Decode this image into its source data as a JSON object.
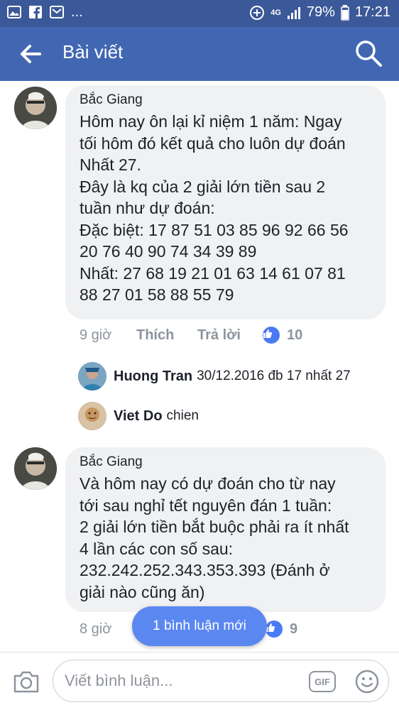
{
  "status_bar": {
    "network": "4G",
    "battery": "79%",
    "time": "17:21",
    "more": "..."
  },
  "header": {
    "title": "Bài viết",
    "back_icon": "arrow-left-icon",
    "search_icon": "search-icon"
  },
  "comments": [
    {
      "author": "Bắc Giang",
      "text": "Hôm nay ôn lại kỉ niệm 1 năm: Ngay\ntối hôm đó kết quả cho luôn dự đoán\nNhất 27.\nĐây là kq của 2 giải lớn tiền sau 2\ntuần như dự đoán:\nĐặc biệt: 17 87 51 03 85 96 92 66 56\n20  76 40 90 74 34 39 89\nNhất: 27 68 19 21 01 63 14 61 07 81\n88 27 01 58 88 55 79",
      "time": "9 giờ",
      "like_label": "Thích",
      "reply_label": "Trả lời",
      "likes": "10",
      "replies": [
        {
          "author": "Huong Tran",
          "text": "30/12.2016 đb 17 nhất  27"
        },
        {
          "author": "Viet Do",
          "text": "chien"
        }
      ]
    },
    {
      "author": "Bắc Giang",
      "text": "Và hôm nay có dự đoán cho từ nay\ntới sau nghỉ tết nguyên đán 1 tuần:\n2 giải lớn tiền bắt buộc phải ra ít nhất\n4 lần các con số sau:\n232.242.252.343.353.393 (Đánh ở\ngiải nào cũng ăn)",
      "time": "8 giờ",
      "likes": "9"
    }
  ],
  "new_comments_pill": "1 bình luận mới",
  "composer": {
    "placeholder": "Viết bình luận...",
    "gif_label": "GIF"
  },
  "colors": {
    "header_bg": "#4267b2",
    "status_bg": "#3b5898",
    "bubble_bg": "#f0f1f3",
    "like_blue": "#4a7af4"
  }
}
